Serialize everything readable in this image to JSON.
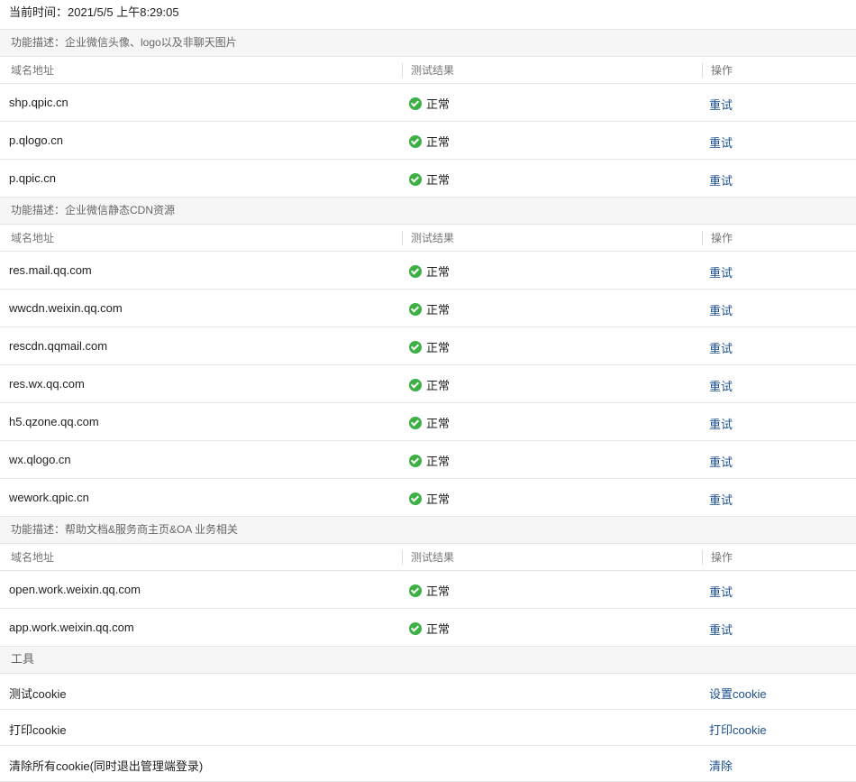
{
  "current_time": "当前时间：2021/5/5 上午8:29:05",
  "columns": {
    "domain": "域名地址",
    "result": "测试结果",
    "action": "操作"
  },
  "status_ok": "正常",
  "retry_label": "重试",
  "sections": [
    {
      "title": "功能描述：企业微信头像、logo以及非聊天图片",
      "rows": [
        "shp.qpic.cn",
        "p.qlogo.cn",
        "p.qpic.cn"
      ]
    },
    {
      "title": "功能描述：企业微信静态CDN资源",
      "rows": [
        "res.mail.qq.com",
        "wwcdn.weixin.qq.com",
        "rescdn.qqmail.com",
        "res.wx.qq.com",
        "h5.qzone.qq.com",
        "wx.qlogo.cn",
        "wework.qpic.cn"
      ]
    },
    {
      "title": "功能描述：帮助文档&服务商主页&OA 业务相关",
      "rows": [
        "open.work.weixin.qq.com",
        "app.work.weixin.qq.com"
      ]
    }
  ],
  "tools": {
    "title": "工具",
    "items": [
      {
        "label": "测试cookie",
        "action": "设置cookie"
      },
      {
        "label": "打印cookie",
        "action": "打印cookie"
      },
      {
        "label": "清除所有cookie(同时退出管理端登录)",
        "action": "清除"
      }
    ]
  },
  "colors": {
    "link": "#1a4f8b",
    "ok": "#3cb043",
    "section_bg": "#f6f6f6"
  }
}
